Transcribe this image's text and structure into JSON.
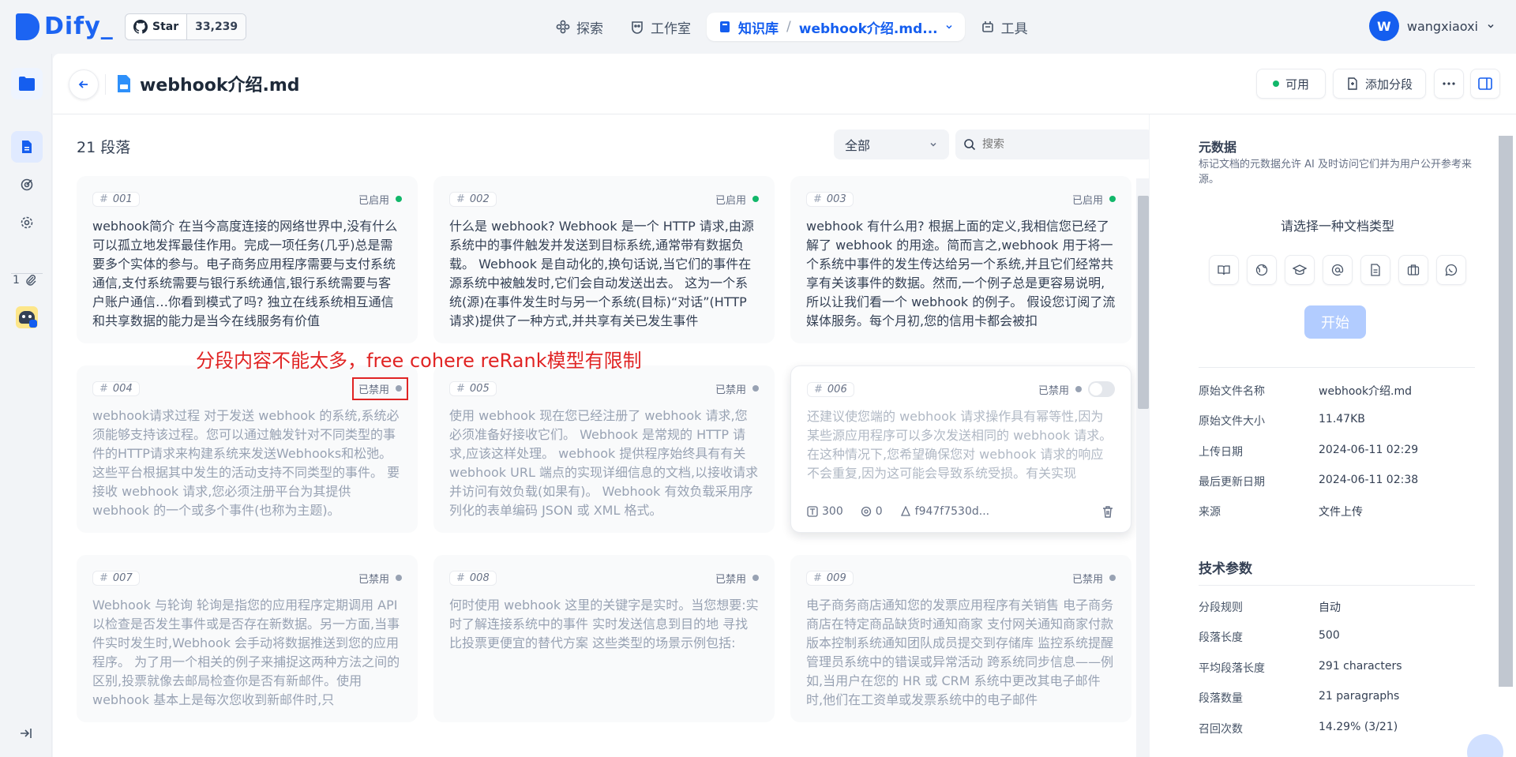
{
  "topnav": {
    "logo_text": "Dify",
    "github": {
      "star_label": "Star",
      "star_count": "33,239"
    },
    "items": [
      {
        "label": "探索",
        "icon": "explore-icon"
      },
      {
        "label": "工作室",
        "icon": "studio-icon"
      },
      {
        "label": "知识库",
        "icon": "book-icon",
        "active": true,
        "crumb": "webhook介绍.md..."
      },
      {
        "label": "工具",
        "icon": "tools-icon"
      }
    ],
    "user": {
      "initial": "W",
      "name": "wangxiaoxi"
    }
  },
  "rail": {
    "attach_count": "1"
  },
  "doc": {
    "title": "webhook介绍.md",
    "status_label": "可用",
    "add_segment_label": "添加分段"
  },
  "list": {
    "segment_count_label": "21 段落",
    "filter_value": "全部",
    "search_placeholder": "搜索"
  },
  "annotation": "分段内容不能太多，free cohere reRank模型有限制",
  "segments": [
    {
      "id": "001",
      "status": "已启用",
      "enabled": true,
      "text": "webhook简介 在当今高度连接的网络世界中,没有什么可以孤立地发挥最佳作用。完成一项任务(几乎)总是需要多个实体的参与。电子商务应用程序需要与支付系统通信,支付系统需要与银行系统通信,银行系统需要与客户账户通信…你看到模式了吗? 独立在线系统相互通信和共享数据的能力是当今在线服务有价值"
    },
    {
      "id": "002",
      "status": "已启用",
      "enabled": true,
      "text": "什么是 webhook? Webhook 是一个 HTTP 请求,由源系统中的事件触发并发送到目标系统,通常带有数据负载。 Webhook 是自动化的,换句话说,当它们的事件在源系统中被触发时,它们会自动发送出去。 这为一个系统(源)在事件发生时与另一个系统(目标)“对话”(HTTP 请求)提供了一种方式,并共享有关已发生事件"
    },
    {
      "id": "003",
      "status": "已启用",
      "enabled": true,
      "text": "webhook 有什么用? 根据上面的定义,我相信您已经了解了 webhook 的用途。简而言之,webhook 用于将一个系统中事件的发生传达给另一个系统,并且它们经常共享有关该事件的数据。然而,一个例子总是更容易说明,所以让我们看一个 webhook 的例子。 假设您订阅了流媒体服务。每个月初,您的信用卡都会被扣"
    },
    {
      "id": "004",
      "status": "已禁用",
      "enabled": false,
      "text": "webhook请求过程 对于发送 webhook 的系统,系统必须能够支持该过程。您可以通过触发针对不同类型的事件的HTTP请求来构建系统来发送Webhooks和松弛。 这些平台根据其中发生的活动支持不同类型的事件。 要接收 webhook 请求,您必须注册平台为其提供 webhook 的一个或多个事件(也称为主题)。"
    },
    {
      "id": "005",
      "status": "已禁用",
      "enabled": false,
      "text": "使用 webhook 现在您已经注册了 webhook 请求,您必须准备好接收它们。 Webhook 是常规的 HTTP 请求,应该这样处理。 webhook 提供程序始终具有有关 webhook URL 端点的实现详细信息的文档,以接收请求并访问有效负载(如果有)。 Webhook 有效负载采用序列化的表单编码 JSON 或 XML 格式。"
    },
    {
      "id": "006",
      "status": "已禁用",
      "enabled": false,
      "text": "还建议使您端的 webhook 请求操作具有幂等性,因为某些源应用程序可以多次发送相同的 webhook 请求。在这种情况下,您希望确保您对 webhook 请求的响应不会重复,因为这可能会导致系统受损。有关实现 webhook 请求的幂等性的更多信息...",
      "words": "300",
      "hits": "0",
      "hash": "f947f7530d..."
    },
    {
      "id": "007",
      "status": "已禁用",
      "enabled": false,
      "text": "Webhook 与轮询 轮询是指您的应用程序定期调用 API 以检查是否发生事件或是否存在新数据。另一方面,当事件实时发生时,Webhook 会手动将数据推送到您的应用程序。 为了用一个相关的例子来捕捉这两种方法之间的区别,投票就像去邮局检查你是否有新邮件。使用 webhook 基本上是每次您收到新邮件时,只"
    },
    {
      "id": "008",
      "status": "已禁用",
      "enabled": false,
      "text": "何时使用 webhook 这里的关键字是实时。当您想要:实时了解连接系统中的事件 实时发送信息到目的地 寻找比投票更便宜的替代方案 这些类型的场景示例包括:"
    },
    {
      "id": "009",
      "status": "已禁用",
      "enabled": false,
      "text": "电子商务商店通知您的发票应用程序有关销售 电子商务商店在特定商品缺货时通知商家 支付网关通知商家付款 版本控制系统通知团队成员提交到存储库 监控系统提醒管理员系统中的错误或异常活动 跨系统同步信息——例如,当用户在您的 HR 或 CRM 系统中更改其电子邮件时,他们在工资单或发票系统中的电子邮件"
    }
  ],
  "metadata": {
    "title": "元数据",
    "desc": "标记文档的元数据允许 AI 及时访问它们并为用户公开参考来源。",
    "choose_label": "请选择一种文档类型",
    "type_icons": [
      "book-icon",
      "web-icon",
      "paper-icon",
      "social-icon",
      "personal-doc-icon",
      "business-doc-icon",
      "chat-icon"
    ],
    "start_label": "开始",
    "file_info": [
      {
        "key": "原始文件名称",
        "value": "webhook介绍.md"
      },
      {
        "key": "原始文件大小",
        "value": "11.47KB"
      },
      {
        "key": "上传日期",
        "value": "2024-06-11 02:29"
      },
      {
        "key": "最后更新日期",
        "value": "2024-06-11 02:38"
      },
      {
        "key": "来源",
        "value": "文件上传"
      }
    ],
    "tech_title": "技术参数",
    "tech_params": [
      {
        "key": "分段规则",
        "value": "自动"
      },
      {
        "key": "段落长度",
        "value": "500"
      },
      {
        "key": "平均段落长度",
        "value": "291 characters"
      },
      {
        "key": "段落数量",
        "value": "21 paragraphs"
      },
      {
        "key": "召回次数",
        "value": "14.29% (3/21)"
      }
    ]
  },
  "colors": {
    "accent": "#155eef",
    "enabled": "#12b76a",
    "disabled": "#98a2b3",
    "annotation": "#e02424"
  }
}
